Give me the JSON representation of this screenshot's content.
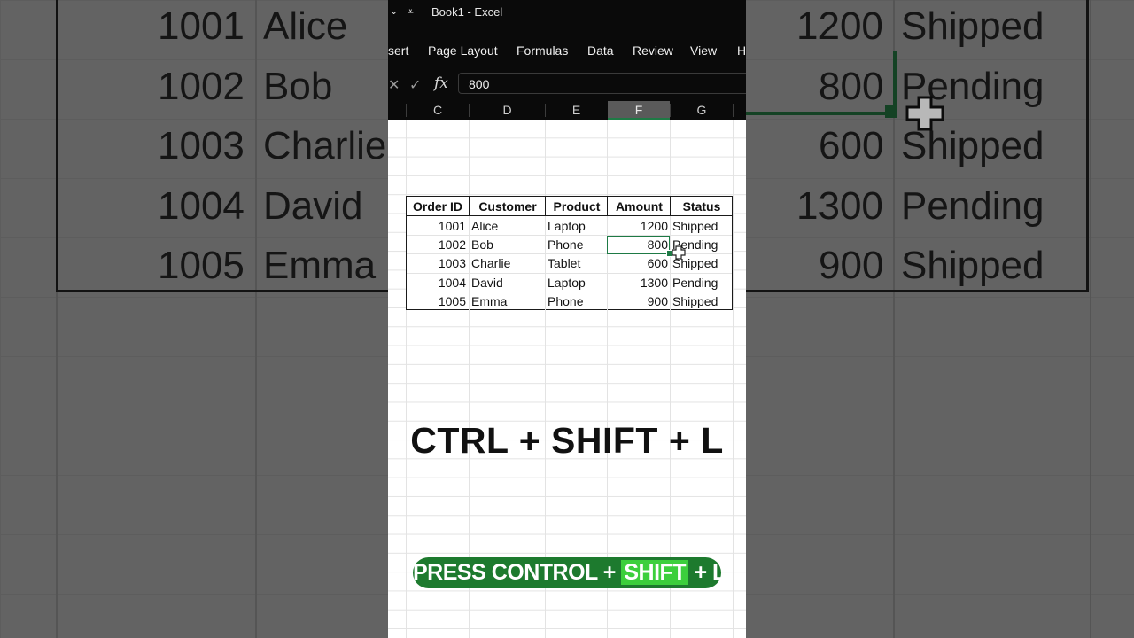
{
  "window": {
    "title": "Book1  -  Excel"
  },
  "ribbon": {
    "tabs": [
      "sert",
      "Page Layout",
      "Formulas",
      "Data",
      "Review",
      "View",
      "H"
    ]
  },
  "formula_bar": {
    "value": "800",
    "fx_label": "fx"
  },
  "columns": [
    "C",
    "D",
    "E",
    "F",
    "G"
  ],
  "active_column": "F",
  "table": {
    "headers": [
      "Order ID",
      "Customer",
      "Product",
      "Amount",
      "Status"
    ],
    "rows": [
      [
        "1001",
        "Alice",
        "Laptop",
        "1200",
        "Shipped"
      ],
      [
        "1002",
        "Bob",
        "Phone",
        "800",
        "Pending"
      ],
      [
        "1003",
        "Charlie",
        "Tablet",
        "600",
        "Shipped"
      ],
      [
        "1004",
        "David",
        "Laptop",
        "1300",
        "Pending"
      ],
      [
        "1005",
        "Emma",
        "Phone",
        "900",
        "Shipped"
      ]
    ],
    "selected_cell": {
      "row": 2,
      "column": "Amount"
    }
  },
  "captions": {
    "shortcut": "CTRL + SHIFT + L",
    "subtitle_pre": "PRESS CONTROL + ",
    "subtitle_highlight": "SHIFT",
    "subtitle_post": " + L."
  },
  "background_zoom": {
    "rows": [
      [
        "1001",
        "Alice",
        "1200",
        "Shipped"
      ],
      [
        "1002",
        "Bob",
        "800",
        "Pending"
      ],
      [
        "1003",
        "Charlie",
        "600",
        "Shipped"
      ],
      [
        "1004",
        "David",
        "1300",
        "Pending"
      ],
      [
        "1005",
        "Emma",
        "900",
        "Shipped"
      ]
    ]
  }
}
